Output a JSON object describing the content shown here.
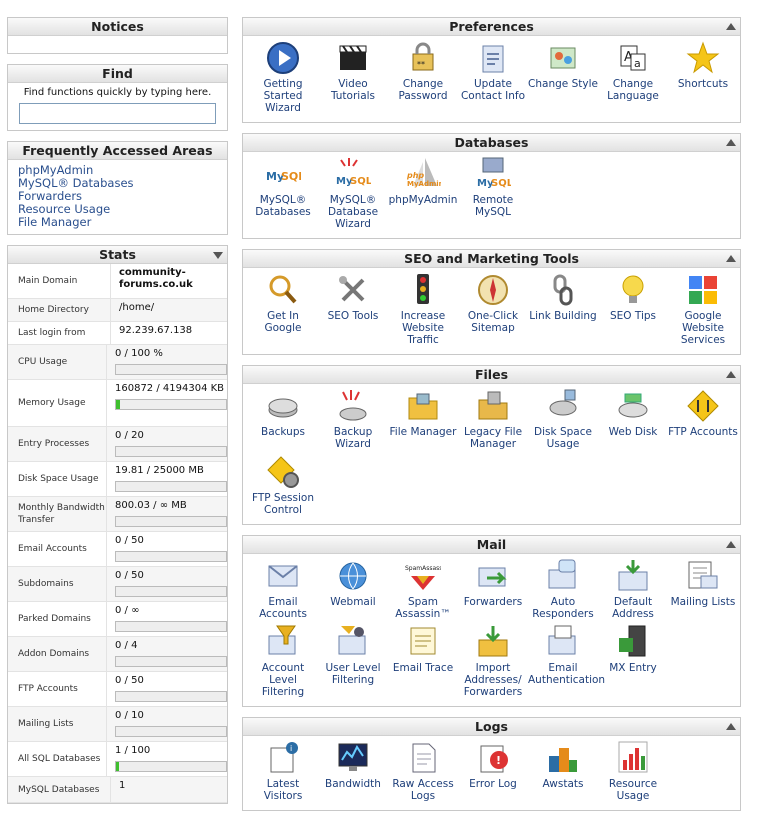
{
  "notices": {
    "title": "Notices"
  },
  "find": {
    "title": "Find",
    "hint": "Find functions quickly by typing here."
  },
  "faa": {
    "title": "Frequently Accessed Areas",
    "items": [
      "phpMyAdmin",
      "MySQL® Databases",
      "Forwarders",
      "Resource Usage",
      "File Manager"
    ]
  },
  "stats": {
    "title": "Stats",
    "rows": [
      {
        "label": "Main Domain",
        "value": "community-forums.co.uk",
        "bold": true
      },
      {
        "label": "Home Directory",
        "value": "/home/"
      },
      {
        "label": "Last login from",
        "value": "92.239.67.138"
      },
      {
        "label": "CPU Usage",
        "value": "0 / 100 %",
        "bar": 0
      },
      {
        "label": "Memory Usage",
        "value": "160872 / 4194304 KB",
        "bar": 0.038
      },
      {
        "label": "Entry Processes",
        "value": "0 / 20",
        "bar": 0
      },
      {
        "label": "Disk Space Usage",
        "value": "19.81 / 25000 MB",
        "bar": 0
      },
      {
        "label": "Monthly Bandwidth Transfer",
        "value": "800.03 / ∞ MB",
        "bar": 0
      },
      {
        "label": "Email Accounts",
        "value": "0 / 50",
        "bar": 0
      },
      {
        "label": "Subdomains",
        "value": "0 / 50",
        "bar": 0
      },
      {
        "label": "Parked Domains",
        "value": "0 / ∞",
        "bar": 0
      },
      {
        "label": "Addon Domains",
        "value": "0 / 4",
        "bar": 0
      },
      {
        "label": "FTP Accounts",
        "value": "0 / 50",
        "bar": 0
      },
      {
        "label": "Mailing Lists",
        "value": "0 / 10",
        "bar": 0
      },
      {
        "label": "All SQL Databases",
        "value": "1 / 100",
        "bar": 0.01
      },
      {
        "label": "MySQL Databases",
        "value": "1"
      }
    ]
  },
  "sections": [
    {
      "title": "Preferences",
      "items": [
        {
          "label": "Getting Started Wizard",
          "icon": "play-icon"
        },
        {
          "label": "Video Tutorials",
          "icon": "clapperboard-icon"
        },
        {
          "label": "Change Password",
          "icon": "password-lock-icon"
        },
        {
          "label": "Update Contact Info",
          "icon": "contact-clipboard-icon"
        },
        {
          "label": "Change Style",
          "icon": "style-palette-icon"
        },
        {
          "label": "Change Language",
          "icon": "language-icon"
        },
        {
          "label": "Shortcuts",
          "icon": "star-icon"
        }
      ]
    },
    {
      "title": "Databases",
      "items": [
        {
          "label": "MySQL® Databases",
          "icon": "mysql-dolphin-icon"
        },
        {
          "label": "MySQL® Database Wizard",
          "icon": "mysql-wizard-icon"
        },
        {
          "label": "phpMyAdmin",
          "icon": "phpmyadmin-sail-icon"
        },
        {
          "label": "Remote MySQL",
          "icon": "remote-mysql-icon"
        }
      ]
    },
    {
      "title": "SEO and Marketing Tools",
      "items": [
        {
          "label": "Get In Google",
          "icon": "magnifier-icon"
        },
        {
          "label": "SEO Tools",
          "icon": "tools-icon"
        },
        {
          "label": "Increase Website Traffic",
          "icon": "traffic-light-icon"
        },
        {
          "label": "One-Click Sitemap",
          "icon": "compass-icon"
        },
        {
          "label": "Link Building",
          "icon": "chain-link-icon"
        },
        {
          "label": "SEO Tips",
          "icon": "lightbulb-icon"
        },
        {
          "label": "Google Website Services",
          "icon": "google-squares-icon"
        }
      ]
    },
    {
      "title": "Files",
      "items": [
        {
          "label": "Backups",
          "icon": "backup-disk-icon"
        },
        {
          "label": "Backup Wizard",
          "icon": "backup-wizard-icon"
        },
        {
          "label": "File Manager",
          "icon": "folder-icon"
        },
        {
          "label": "Legacy File Manager",
          "icon": "legacy-folder-icon"
        },
        {
          "label": "Disk Space Usage",
          "icon": "disk-usage-icon"
        },
        {
          "label": "Web Disk",
          "icon": "web-disk-icon"
        },
        {
          "label": "FTP Accounts",
          "icon": "ftp-arrows-icon"
        },
        {
          "label": "FTP Session Control",
          "icon": "ftp-gear-icon"
        }
      ]
    },
    {
      "title": "Mail",
      "items": [
        {
          "label": "Email Accounts",
          "icon": "envelope-icon"
        },
        {
          "label": "Webmail",
          "icon": "webmail-globe-icon"
        },
        {
          "label": "Spam Assassin™",
          "icon": "spamassassin-icon"
        },
        {
          "label": "Forwarders",
          "icon": "forward-envelope-icon"
        },
        {
          "label": "Auto Responders",
          "icon": "auto-responder-icon"
        },
        {
          "label": "Default Address",
          "icon": "default-address-icon"
        },
        {
          "label": "Mailing Lists",
          "icon": "mailing-list-icon"
        },
        {
          "label": "Account Level Filtering",
          "icon": "filter-envelope-icon"
        },
        {
          "label": "User Level Filtering",
          "icon": "user-filter-icon"
        },
        {
          "label": "Email Trace",
          "icon": "trace-icon"
        },
        {
          "label": "Import Addresses/ Forwarders",
          "icon": "import-box-icon"
        },
        {
          "label": "Email Authentication",
          "icon": "auth-envelope-icon"
        },
        {
          "label": "MX Entry",
          "icon": "mx-server-icon"
        }
      ]
    },
    {
      "title": "Logs",
      "items": [
        {
          "label": "Latest Visitors",
          "icon": "visitors-icon"
        },
        {
          "label": "Bandwidth",
          "icon": "bandwidth-monitor-icon"
        },
        {
          "label": "Raw Access Logs",
          "icon": "raw-logs-icon"
        },
        {
          "label": "Error Log",
          "icon": "error-icon"
        },
        {
          "label": "Awstats",
          "icon": "awstats-cubes-icon"
        },
        {
          "label": "Resource Usage",
          "icon": "resource-chart-icon"
        }
      ]
    }
  ]
}
